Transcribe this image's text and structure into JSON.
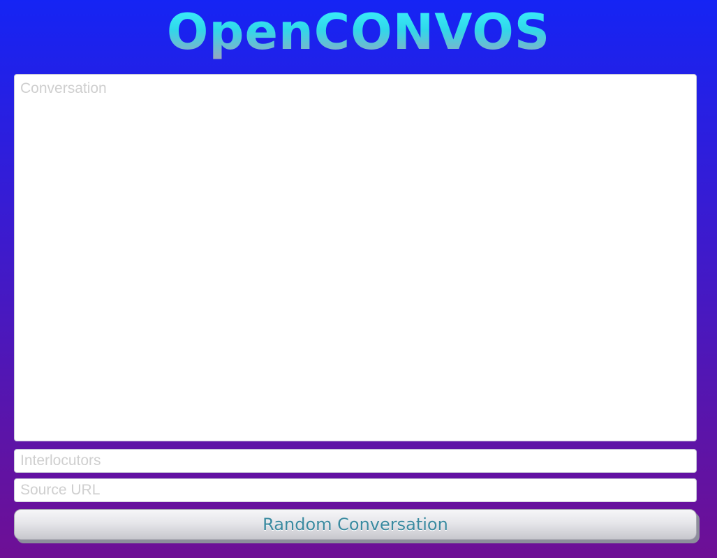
{
  "app": {
    "title": "OpenCONVOS"
  },
  "form": {
    "conversation": {
      "placeholder": "Conversation",
      "value": ""
    },
    "interlocutors": {
      "placeholder": "Interlocutors",
      "value": ""
    },
    "source_url": {
      "placeholder": "Source URL",
      "value": ""
    }
  },
  "actions": {
    "random_label": "Random Conversation"
  },
  "colors": {
    "background_top": "#1524f4",
    "background_bottom": "#6e0f95",
    "logo": "#3df2ff",
    "button_text": "#3a8aa0"
  }
}
